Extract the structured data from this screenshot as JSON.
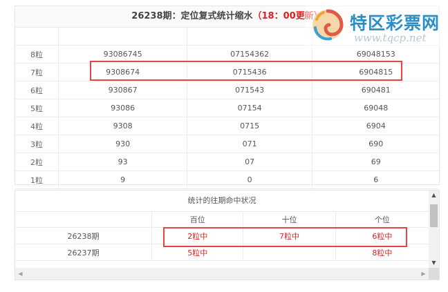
{
  "panel1": {
    "title_main": "26238期：定位复式统计缩水",
    "title_update": "（18：00更新）",
    "rows": [
      {
        "label": "8粒",
        "c1": "93086745",
        "c2": "07154362",
        "c3": "69048153"
      },
      {
        "label": "7粒",
        "c1": "9308674",
        "c2": "0715436",
        "c3": "6904815"
      },
      {
        "label": "6粒",
        "c1": "930867",
        "c2": "071543",
        "c3": "690481"
      },
      {
        "label": "5粒",
        "c1": "93086",
        "c2": "07154",
        "c3": "69048"
      },
      {
        "label": "4粒",
        "c1": "9308",
        "c2": "0715",
        "c3": "6904"
      },
      {
        "label": "3粒",
        "c1": "930",
        "c2": "071",
        "c3": "690"
      },
      {
        "label": "2粒",
        "c1": "93",
        "c2": "07",
        "c3": "69"
      },
      {
        "label": "1粒",
        "c1": "9",
        "c2": "0",
        "c3": "6"
      }
    ]
  },
  "logo": {
    "brand": "特区彩票网",
    "url": "www.tqcp.net"
  },
  "panel2": {
    "heading": "统计的往期命中状况",
    "columns": [
      "",
      "百位",
      "十位",
      "个位"
    ],
    "rows": [
      {
        "period": "26238期",
        "hundreds": "2粒中",
        "tens": "7粒中",
        "ones": "6粒中"
      },
      {
        "period": "26237期",
        "hundreds": "5粒中",
        "tens": "",
        "ones": "8粒中"
      }
    ],
    "scroll_up": "▲",
    "scroll_down": "▼",
    "scroll_left": "◀",
    "scroll_right": "▶"
  },
  "colors": {
    "highlight": "#e84343",
    "hit_text": "#e02020",
    "brand": "#2a8fc8"
  }
}
